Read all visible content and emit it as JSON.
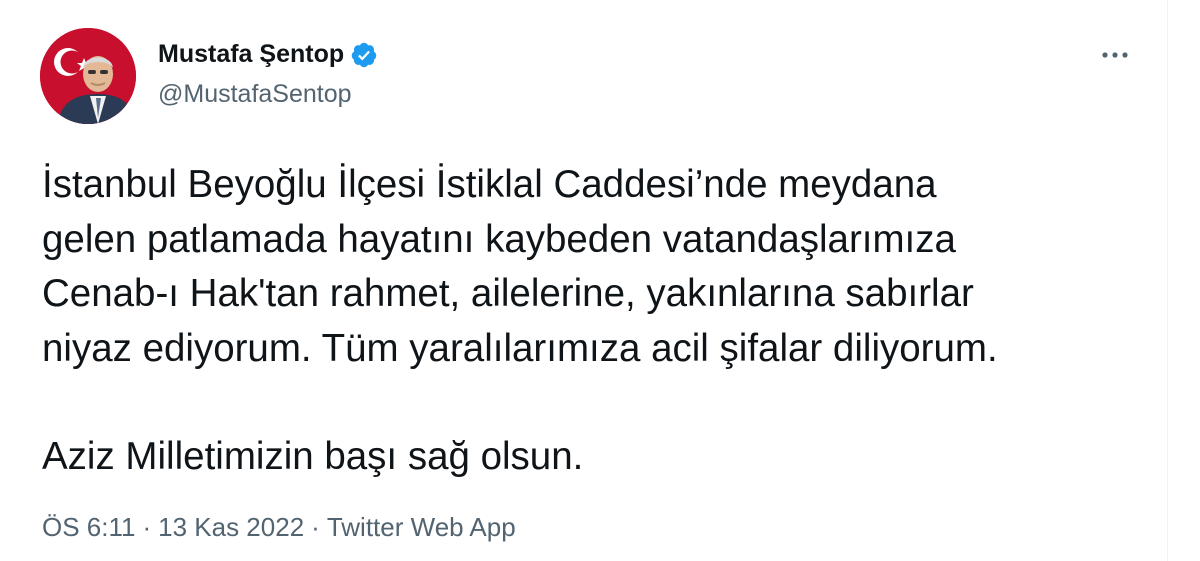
{
  "author": {
    "name": "Mustafa Şentop",
    "handle": "@MustafaSentop",
    "verified_badge": "verified-badge-icon",
    "avatar_icon": "profile-avatar",
    "brand_color": "#1d9bf0"
  },
  "menu": {
    "icon": "more-options-icon"
  },
  "tweet": {
    "lines": [
      "İstanbul Beyoğlu İlçesi İstiklal Caddesi’nde meydana",
      "gelen patlamada hayatını kaybeden vatandaşlarımıza",
      "Cenab-ı Hak'tan rahmet, ailelerine, yakınlarına sabırlar",
      "niyaz ediyorum. Tüm yaralılarımıza acil şifalar diliyorum."
    ],
    "closing": "Aziz Milletimizin başı sağ olsun."
  },
  "meta": {
    "time": "ÖS 6:11",
    "separator": "·",
    "date": "13 Kas 2022",
    "source": "Twitter Web App"
  }
}
